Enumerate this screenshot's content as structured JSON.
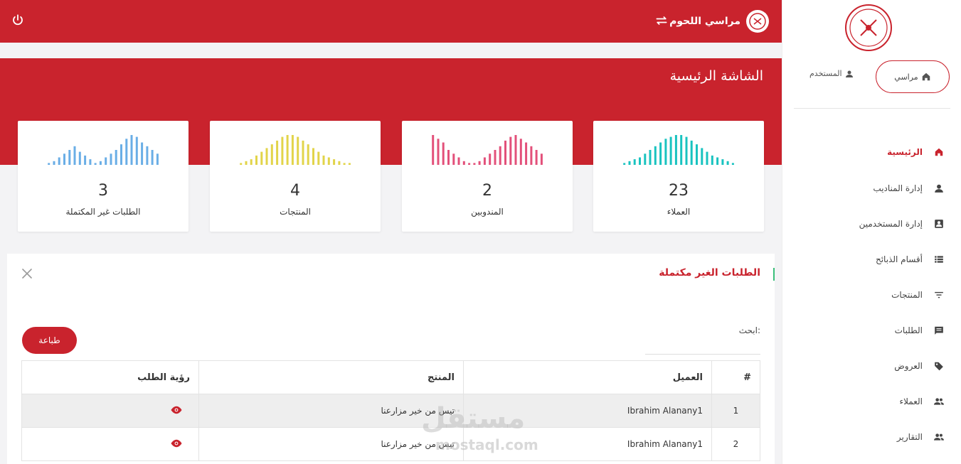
{
  "header": {
    "brand_name": "مراسي اللحوم"
  },
  "hero": {
    "title": "الشاشة الرئيسية"
  },
  "stats": [
    {
      "label": "العملاء",
      "value": "23",
      "color": "#19c3c0"
    },
    {
      "label": "المندوبين",
      "value": "2",
      "color": "#e3507a"
    },
    {
      "label": "المنتجات",
      "value": "4",
      "color": "#e2d44a"
    },
    {
      "label": "الطلبات غير المكتملة",
      "value": "3",
      "color": "#6aaee6"
    }
  ],
  "panel": {
    "title": "الطلبات الغير مكتملة",
    "search_label": "ابحث:",
    "print_label": "طباعة",
    "columns": [
      "#",
      "العميل",
      "المنتج",
      "رؤية الطلب"
    ],
    "rows": [
      {
        "idx": "1",
        "client": "Ibrahim Alanany1",
        "product": "تيس من خير مزارعنا"
      },
      {
        "idx": "2",
        "client": "Ibrahim Alanany1",
        "product": "تيس من خير مزارعنا"
      }
    ]
  },
  "sidebar": {
    "home_button": "مراسي",
    "user_label": "المستخدم",
    "items": [
      {
        "label": "الرئيسية",
        "icon": "home-icon",
        "active": true
      },
      {
        "label": "إدارة المناديب",
        "icon": "person-icon"
      },
      {
        "label": "إدارة المستخدمين",
        "icon": "id-card-icon"
      },
      {
        "label": "أقسام الذبائح",
        "icon": "list-icon"
      },
      {
        "label": "المنتجات",
        "icon": "filter-icon"
      },
      {
        "label": "الطلبات",
        "icon": "message-icon"
      },
      {
        "label": "العروض",
        "icon": "tag-icon"
      },
      {
        "label": "العملاء",
        "icon": "people-icon"
      },
      {
        "label": "التقارير",
        "icon": "people-icon"
      }
    ]
  },
  "watermark": {
    "text": "مستقل",
    "subtext": "mostaql.com"
  },
  "colors": {
    "brand": "#c9232d",
    "accent_green": "#3bbf7a"
  }
}
